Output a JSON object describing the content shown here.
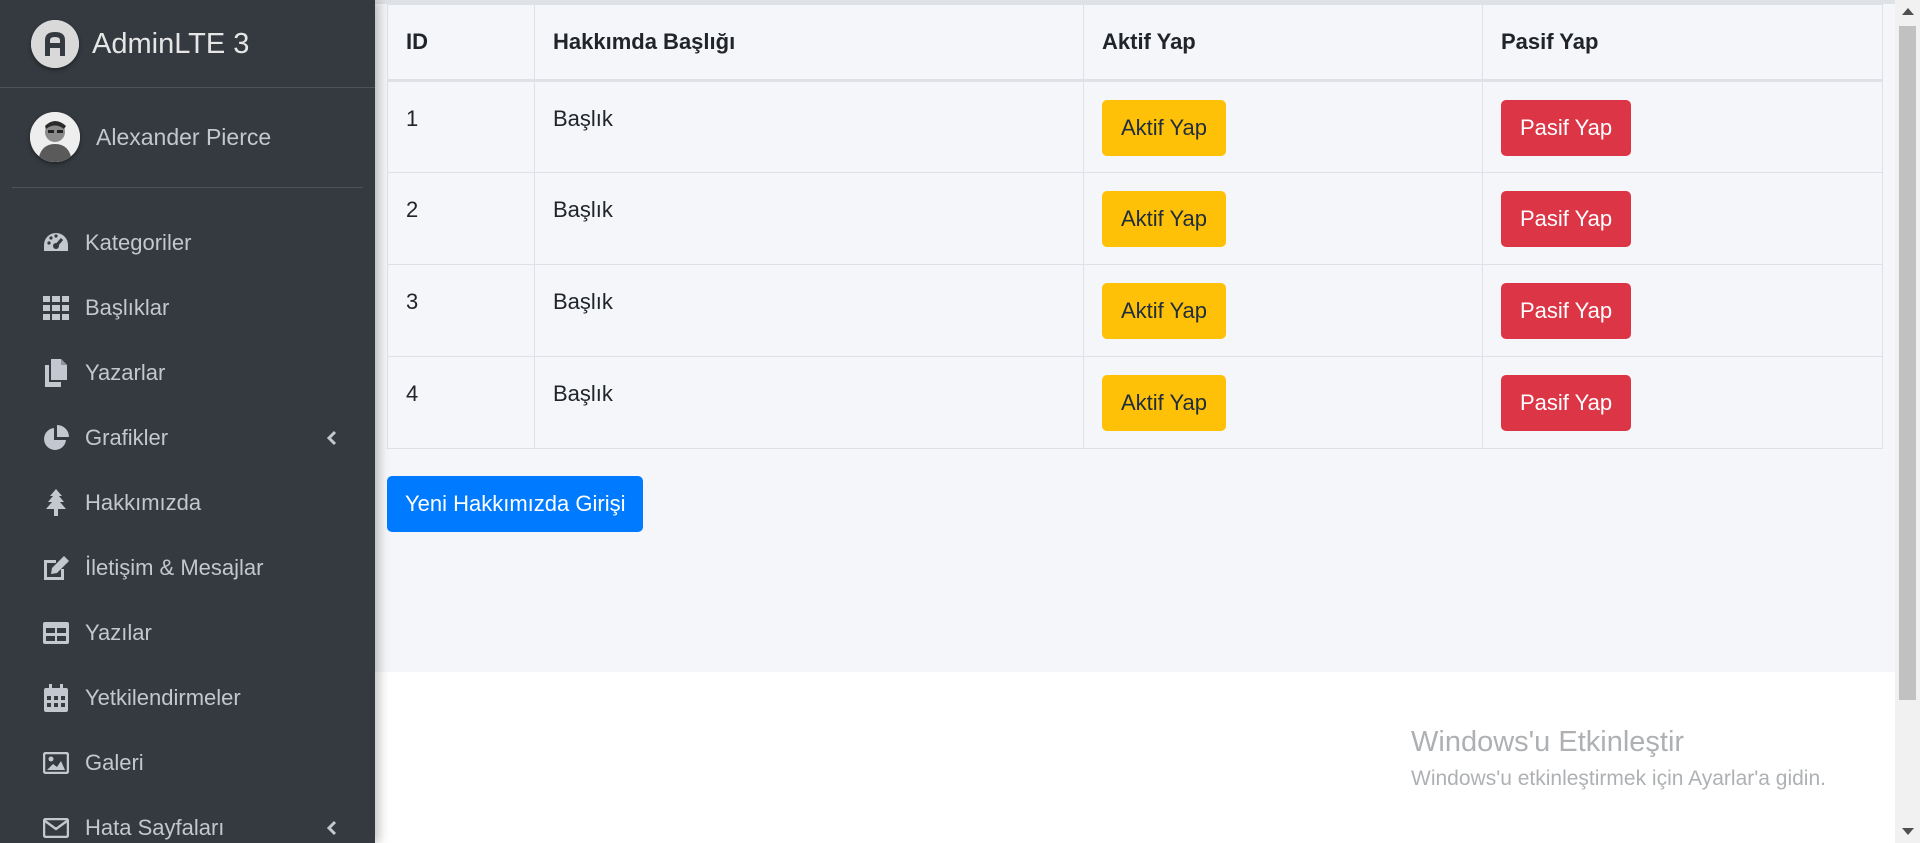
{
  "brand": {
    "name": "AdminLTE 3"
  },
  "user": {
    "name": "Alexander Pierce"
  },
  "sidebar": {
    "items": [
      {
        "label": "Kategoriler",
        "icon": "tachometer-icon",
        "has_chevron": false
      },
      {
        "label": "Başlıklar",
        "icon": "grid-icon",
        "has_chevron": false
      },
      {
        "label": "Yazarlar",
        "icon": "copy-icon",
        "has_chevron": false
      },
      {
        "label": "Grafikler",
        "icon": "chart-pie-icon",
        "has_chevron": true
      },
      {
        "label": "Hakkımızda",
        "icon": "tree-icon",
        "has_chevron": false
      },
      {
        "label": "İletişim & Mesajlar",
        "icon": "edit-icon",
        "has_chevron": false
      },
      {
        "label": "Yazılar",
        "icon": "table-icon",
        "has_chevron": false
      },
      {
        "label": "Yetkilendirmeler",
        "icon": "calendar-icon",
        "has_chevron": false
      },
      {
        "label": "Galeri",
        "icon": "image-icon",
        "has_chevron": false
      },
      {
        "label": "Hata Sayfaları",
        "icon": "envelope-icon",
        "has_chevron": true
      }
    ]
  },
  "table": {
    "headers": [
      "ID",
      "Hakkımda Başlığı",
      "Aktif Yap",
      "Pasif Yap"
    ],
    "rows": [
      {
        "id": "1",
        "title": "Başlık",
        "activate": "Aktif Yap",
        "deactivate": "Pasif Yap"
      },
      {
        "id": "2",
        "title": "Başlık",
        "activate": "Aktif Yap",
        "deactivate": "Pasif Yap"
      },
      {
        "id": "3",
        "title": "Başlık",
        "activate": "Aktif Yap",
        "deactivate": "Pasif Yap"
      },
      {
        "id": "4",
        "title": "Başlık",
        "activate": "Aktif Yap",
        "deactivate": "Pasif Yap"
      }
    ]
  },
  "new_button": {
    "label": "Yeni Hakkımızda Girişi"
  },
  "watermark": {
    "title": "Windows'u Etkinleştir",
    "subtitle": "Windows'u etkinleştirmek için Ayarlar'a gidin."
  },
  "colors": {
    "sidebar_bg": "#343a40",
    "content_bg": "#f4f6f9",
    "warning": "#ffc107",
    "danger": "#dc3545",
    "primary": "#007bff"
  }
}
